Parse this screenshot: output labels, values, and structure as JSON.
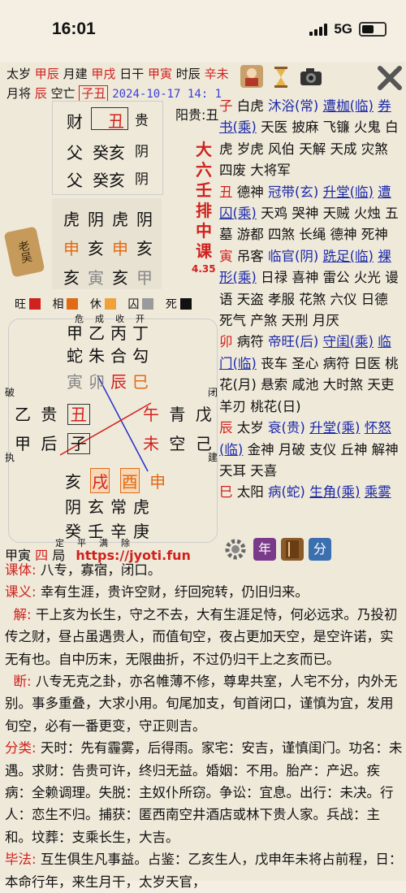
{
  "status": {
    "time": "16:01",
    "network": "5G"
  },
  "header": {
    "line1": [
      {
        "k": "太岁",
        "v": "甲辰"
      },
      {
        "k": "月建",
        "v": "甲戌"
      },
      {
        "k": "日干",
        "v": "甲寅"
      },
      {
        "k": "时辰",
        "v": "辛未"
      }
    ],
    "yuejiang_label": "月将",
    "yuejiang": "辰",
    "kongwang_label": "空亡",
    "kongwang": "子丑",
    "datetime": "2024-10-17 14: 1",
    "yanggui": "阳贵:丑"
  },
  "sanchuan": [
    {
      "a": "财",
      "b": "丑",
      "c": "贵"
    },
    {
      "a": "父",
      "b": "癸亥",
      "c": "阴"
    },
    {
      "a": "父",
      "b": "癸亥",
      "c": "阴"
    }
  ],
  "sike": {
    "row1": [
      "虎",
      "阴",
      "虎",
      "阴"
    ],
    "row2": [
      "申",
      "亥",
      "申",
      "亥"
    ],
    "row3": [
      "亥",
      "寅",
      "亥",
      "甲"
    ]
  },
  "calligraphy": [
    "大",
    "六",
    "壬",
    "排",
    "中",
    "课"
  ],
  "version": "4.35",
  "badge": "老吴",
  "wangxiang": [
    {
      "label": "旺",
      "color": "#d0211c"
    },
    {
      "label": "相",
      "color": "#e26a14"
    },
    {
      "label": "休",
      "color": "#f0a23a"
    },
    {
      "label": "囚",
      "color": "#9a9a9a"
    },
    {
      "label": "死",
      "color": "#111111"
    }
  ],
  "tianpan": {
    "top_labels": [
      "危",
      "成",
      "收",
      "开"
    ],
    "top_row1": [
      "甲",
      "乙",
      "丙",
      "丁"
    ],
    "top_row2": [
      "蛇",
      "朱",
      "合",
      "勾"
    ],
    "top_row3": [
      "寅",
      "卯",
      "辰",
      "巳"
    ],
    "left_edge": "破",
    "left_edge2": "执",
    "right_edge": "闭",
    "right_edge2": "建",
    "mid_left_a": [
      "乙",
      "贵",
      "丑"
    ],
    "mid_left_b": [
      "甲",
      "后",
      "子"
    ],
    "mid_right_a": [
      "午",
      "青",
      "戊"
    ],
    "mid_right_b": [
      "未",
      "空",
      "己"
    ],
    "bot_row1": [
      "亥",
      "戌",
      "酉",
      "申"
    ],
    "bot_row2": [
      "阴",
      "玄",
      "常",
      "虎"
    ],
    "bot_row3": [
      "癸",
      "壬",
      "辛",
      "庚"
    ],
    "bot_labels": [
      "定",
      "平",
      "满",
      "除"
    ]
  },
  "footer_left": {
    "ganzhi": "甲寅",
    "ju_num": "四",
    "ju": "局",
    "url": "https://jyoti.fun"
  },
  "icons": {
    "nian": "年",
    "fen": "分"
  },
  "right_panel": [
    {
      "zhi": "子",
      "shen": "白虎",
      "cs": "沐浴",
      "cs2": "(常)",
      "link": "遭枷(临)",
      "link2": "券书(乘)",
      "text": "天医 披麻 飞镰 火鬼 白虎 岁虎 风伯 天解 天成 灾煞 四废 大将军"
    },
    {
      "zhi": "丑",
      "shen": "德神",
      "cs": "冠带",
      "cs2": "(玄)",
      "link": "升堂(临)",
      "link2": "遭囚(乘)",
      "text": "天鸡 哭神 天贼 火烛 五墓 游都 四煞 长绳 德神 死神"
    },
    {
      "zhi": "寅",
      "shen": "吊客",
      "cs": "临官",
      "cs2": "(阴)",
      "link": "跣足(临)",
      "link2": "裸形(乘)",
      "text": "日禄 喜神 雷公 火光 谩语 天盗 孝服 花煞 六仪 日德 死气 产煞 天刑 月厌"
    },
    {
      "zhi": "卯",
      "shen": "病符",
      "cs": "帝旺",
      "cs2": "(后)",
      "link": "守闺(乘)",
      "link2": "临门(临)",
      "text": "丧车 圣心 病符 日医 桃花(月) 悬索 咸池 大时煞 天吏 羊刃 桃花(日)"
    },
    {
      "zhi": "辰",
      "shen": "太岁",
      "cs": "衰",
      "cs2": "(贵)",
      "link": "升堂(乘)",
      "link2": "怀怒(临)",
      "text": "金神 月破 支仪 丘神 解神 天耳 天喜"
    },
    {
      "zhi": "巳",
      "shen": "太阳",
      "cs": "病",
      "cs2": "(蛇)",
      "link": "生角(乘)",
      "link2": "乘雾",
      "text": ""
    }
  ],
  "bottom": [
    {
      "label": "课体:",
      "text": "八专，寡宿，闭口。"
    },
    {
      "label": "课义:",
      "text": "幸有生涯，贵许空财，纡回宛转，仍旧归来。"
    },
    {
      "label": "解:",
      "text": "干上亥为长生，守之不去，大有生涯足恃，何必远求。乃投初传之财，昼占虽遇贵人，而值旬空，夜占更加天空，是空许诺，实无有也。自中历末，无限曲折，不过仍归干上之亥而已。"
    },
    {
      "label": "断:",
      "text": "八专无克之卦，亦名帷薄不修，尊卑共室，人宅不分，内外无别。事多重叠，大求小用。旬尾加支，旬首闭口，谨慎为宜，发用旬空，必有一番更变，守正则吉。"
    },
    {
      "label": "分类:",
      "text": "天时：先有霾雾，后得雨。家宅：安吉，谨慎闺门。功名：未遇。求财：告贵可许，终归无益。婚姻：不用。胎产：产迟。疾病：全赖调理。失脱：主奴仆所窃。争讼：宜息。出行：未决。行人：恋生不归。捕获：匿西南空井酒店或林下贵人家。兵战：主和。坟葬：支乘长生，大吉。"
    },
    {
      "label": "毕法:",
      "text": "互生俱生凡事益。占鉴：乙亥生人，戊申年未将占前程，日：本命行年，来生月干，太岁天官，"
    }
  ]
}
